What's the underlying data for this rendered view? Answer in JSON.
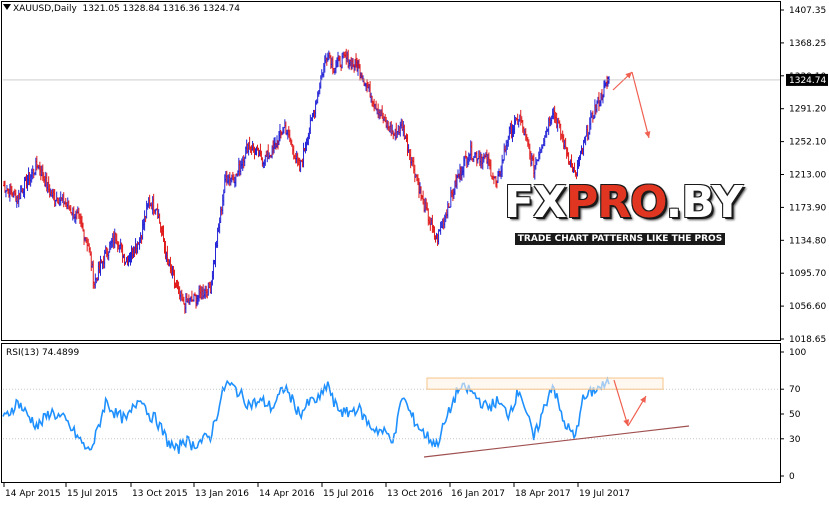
{
  "header": {
    "symbol": "XAUUSD,Daily",
    "ohlc": "1321.05 1328.84 1316.36 1324.74"
  },
  "indicator": {
    "label": "RSI(13) 74.4899"
  },
  "watermark": {
    "brand_left": "FX",
    "brand_mid": "PRO",
    "brand_right": ".BY",
    "tagline": "TRADE CHART PATTERNS LIKE THE PROS"
  },
  "colors": {
    "bull": "#2323d6",
    "bear": "#e01818",
    "rsi": "#1e90ff",
    "trendline": "#a05050",
    "arrow": "#f06050",
    "zone": "#f5c48a"
  },
  "chart_data": [
    {
      "type": "line",
      "title": "XAUUSD,Daily",
      "current_price_label": "1324.74",
      "ylim": [
        1018.65,
        1407.35
      ],
      "y_tick_labels": [
        "1407.35",
        "1368.25",
        "1330.10",
        "1291.20",
        "1252.10",
        "1213.00",
        "1173.90",
        "1134.80",
        "1095.70",
        "1056.60",
        "1018.65"
      ],
      "x_tick_labels": [
        "14 Apr 2015",
        "15 Jul 2015",
        "13 Oct 2015",
        "13 Jan 2016",
        "14 Apr 2016",
        "15 Jul 2016",
        "13 Oct 2016",
        "16 Jan 2017",
        "18 Apr 2017",
        "19 Jul 2017"
      ],
      "x": [
        "2015-03-10",
        "2015-04-01",
        "2015-04-14",
        "2015-05-01",
        "2015-05-20",
        "2015-06-10",
        "2015-07-01",
        "2015-07-15",
        "2015-07-24",
        "2015-08-10",
        "2015-08-25",
        "2015-09-10",
        "2015-10-01",
        "2015-10-13",
        "2015-10-25",
        "2015-11-10",
        "2015-11-25",
        "2015-12-03",
        "2015-12-18",
        "2016-01-13",
        "2016-02-05",
        "2016-02-20",
        "2016-03-10",
        "2016-04-01",
        "2016-04-14",
        "2016-05-03",
        "2016-05-25",
        "2016-06-10",
        "2016-06-24",
        "2016-07-06",
        "2016-07-15",
        "2016-08-01",
        "2016-08-20",
        "2016-09-07",
        "2016-09-28",
        "2016-10-13",
        "2016-10-25",
        "2016-11-08",
        "2016-11-25",
        "2016-12-15",
        "2017-01-16",
        "2017-02-01",
        "2017-02-28",
        "2017-03-15",
        "2017-04-01",
        "2017-04-18",
        "2017-05-09",
        "2017-06-06",
        "2017-06-21",
        "2017-07-10",
        "2017-07-19",
        "2017-08-08",
        "2017-08-29"
      ],
      "series": [
        {
          "values": [
            1200,
            1185,
            1205,
            1225,
            1190,
            1180,
            1160,
            1130,
            1085,
            1120,
            1140,
            1110,
            1140,
            1180,
            1175,
            1110,
            1075,
            1060,
            1065,
            1080,
            1210,
            1210,
            1250,
            1230,
            1240,
            1270,
            1220,
            1270,
            1320,
            1360,
            1340,
            1350,
            1340,
            1310,
            1275,
            1260,
            1270,
            1230,
            1180,
            1135,
            1210,
            1240,
            1230,
            1200,
            1260,
            1280,
            1220,
            1290,
            1255,
            1210,
            1240,
            1290,
            1325
          ]
        }
      ]
    },
    {
      "type": "line",
      "title": "RSI(13) 74.4899",
      "ylim": [
        0,
        100
      ],
      "y_tick_labels": [
        "100",
        "70",
        "50",
        "30",
        "0"
      ],
      "series": [
        {
          "values": [
            45,
            60,
            50,
            40,
            52,
            45,
            30,
            20,
            28,
            60,
            50,
            45,
            65,
            50,
            45,
            28,
            20,
            30,
            25,
            32,
            75,
            70,
            58,
            60,
            55,
            72,
            50,
            60,
            62,
            75,
            58,
            50,
            55,
            40,
            35,
            30,
            65,
            48,
            35,
            25,
            70,
            70,
            55,
            60,
            50,
            70,
            30,
            75,
            45,
            30,
            60,
            70,
            74
          ]
        }
      ]
    }
  ]
}
